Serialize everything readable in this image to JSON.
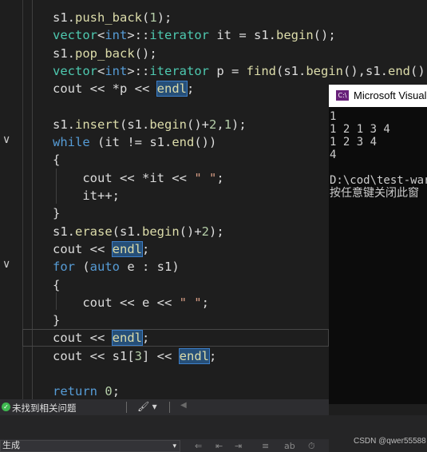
{
  "editor": {
    "lines": [
      [
        {
          "t": "s1",
          "c": ""
        },
        {
          "t": ".",
          "c": ""
        },
        {
          "t": "push_back",
          "c": "fn"
        },
        {
          "t": "(",
          "c": ""
        },
        {
          "t": "1",
          "c": "num"
        },
        {
          "t": ");",
          "c": ""
        }
      ],
      [
        {
          "t": "vector",
          "c": "ty"
        },
        {
          "t": "<",
          "c": ""
        },
        {
          "t": "int",
          "c": "kw"
        },
        {
          "t": ">::",
          "c": ""
        },
        {
          "t": "iterator",
          "c": "ty"
        },
        {
          "t": " it = s1.",
          "c": ""
        },
        {
          "t": "begin",
          "c": "fn"
        },
        {
          "t": "();",
          "c": ""
        }
      ],
      [
        {
          "t": "s1.",
          "c": ""
        },
        {
          "t": "pop_back",
          "c": "fn"
        },
        {
          "t": "();",
          "c": ""
        }
      ],
      [
        {
          "t": "vector",
          "c": "ty"
        },
        {
          "t": "<",
          "c": ""
        },
        {
          "t": "int",
          "c": "kw"
        },
        {
          "t": ">::",
          "c": ""
        },
        {
          "t": "iterator",
          "c": "ty"
        },
        {
          "t": " p = ",
          "c": ""
        },
        {
          "t": "find",
          "c": "fn"
        },
        {
          "t": "(s1.",
          "c": ""
        },
        {
          "t": "begin",
          "c": "fn"
        },
        {
          "t": "(),s1.",
          "c": ""
        },
        {
          "t": "end",
          "c": "fn"
        },
        {
          "t": "(),",
          "c": ""
        }
      ],
      [
        {
          "t": "cout << *p << ",
          "c": ""
        },
        {
          "t": "endl",
          "c": "fn hl"
        },
        {
          "t": ";",
          "c": ""
        }
      ],
      [],
      [
        {
          "t": "s1.",
          "c": ""
        },
        {
          "t": "insert",
          "c": "fn"
        },
        {
          "t": "(s1.",
          "c": ""
        },
        {
          "t": "begin",
          "c": "fn"
        },
        {
          "t": "()+",
          "c": ""
        },
        {
          "t": "2",
          "c": "num"
        },
        {
          "t": ",",
          "c": ""
        },
        {
          "t": "1",
          "c": "num"
        },
        {
          "t": ");",
          "c": ""
        }
      ],
      [
        {
          "t": "while",
          "c": "kw"
        },
        {
          "t": " (it != s1.",
          "c": ""
        },
        {
          "t": "end",
          "c": "fn"
        },
        {
          "t": "())",
          "c": ""
        }
      ],
      [
        {
          "t": "{",
          "c": ""
        }
      ],
      [
        {
          "t": "    cout << *it << ",
          "c": ""
        },
        {
          "t": "\" \"",
          "c": "str"
        },
        {
          "t": ";",
          "c": ""
        }
      ],
      [
        {
          "t": "    it++;",
          "c": ""
        }
      ],
      [
        {
          "t": "}",
          "c": ""
        }
      ],
      [
        {
          "t": "s1.",
          "c": ""
        },
        {
          "t": "erase",
          "c": "fn"
        },
        {
          "t": "(s1.",
          "c": ""
        },
        {
          "t": "begin",
          "c": "fn"
        },
        {
          "t": "()+",
          "c": ""
        },
        {
          "t": "2",
          "c": "num"
        },
        {
          "t": ");",
          "c": ""
        }
      ],
      [
        {
          "t": "cout << ",
          "c": ""
        },
        {
          "t": "endl",
          "c": "fn hl"
        },
        {
          "t": ";",
          "c": ""
        }
      ],
      [
        {
          "t": "for",
          "c": "kw"
        },
        {
          "t": " (",
          "c": ""
        },
        {
          "t": "auto",
          "c": "kw"
        },
        {
          "t": " e : s1)",
          "c": ""
        }
      ],
      [
        {
          "t": "{",
          "c": ""
        }
      ],
      [
        {
          "t": "    cout << e << ",
          "c": ""
        },
        {
          "t": "\" \"",
          "c": "str"
        },
        {
          "t": ";",
          "c": ""
        }
      ],
      [
        {
          "t": "}",
          "c": ""
        }
      ],
      [
        {
          "t": "cout << ",
          "c": ""
        },
        {
          "t": "endl",
          "c": "fn hl"
        },
        {
          "t": ";",
          "c": ""
        }
      ],
      [
        {
          "t": "cout << s1[",
          "c": ""
        },
        {
          "t": "3",
          "c": "num"
        },
        {
          "t": "] << ",
          "c": ""
        },
        {
          "t": "endl",
          "c": "fn hl"
        },
        {
          "t": ";",
          "c": ""
        }
      ],
      [],
      [
        {
          "t": "return",
          "c": "kw"
        },
        {
          "t": " ",
          "c": ""
        },
        {
          "t": "0",
          "c": "num"
        },
        {
          "t": ";",
          "c": ""
        }
      ]
    ],
    "fold_markers": [
      {
        "line": 7,
        "symbol": "∨"
      },
      {
        "line": 14,
        "symbol": "∨"
      }
    ]
  },
  "console": {
    "icon_label": "C:\\",
    "title": "Microsoft Visual Studio 调试控制台",
    "output": "1\n1 2 1 3 4\n1 2 3 4\n4\n\nD:\\cod\\test-ware\n按任意键关闭此窗"
  },
  "statusbar": {
    "ok_icon": "check-circle-icon",
    "issues_text": "未找到相关问题",
    "tool_glyph": "🖌",
    "tool_caret": "▾",
    "arrow_glyph": "◀"
  },
  "output_panel": {
    "source_label": "生成",
    "caret": "▾",
    "tool_glyphs": [
      "⇐",
      "⇤",
      "⇥",
      "≡",
      "ab",
      "⏱"
    ]
  },
  "watermark": "CSDN @qwer55588",
  "colors": {
    "editor_bg": "#1e1e1e",
    "keyword": "#569cd6",
    "type": "#4ec9b0",
    "function": "#dcdcaa",
    "number": "#b5cea8",
    "string": "#d69d85",
    "highlight": "#264f78",
    "console_bg": "#0c0c0c"
  }
}
